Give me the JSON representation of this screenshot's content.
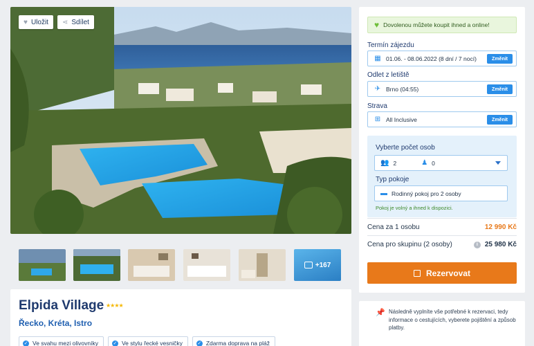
{
  "hero": {
    "save_label": "Uložit",
    "share_label": "Sdílet"
  },
  "gallery": {
    "more_label": "+167"
  },
  "hotel": {
    "name": "Elpida Village",
    "stars": "★★★★",
    "location": "Řecko, Kréta, Istro",
    "tags": [
      "Ve svahu mezi olivovníky",
      "Ve stylu řecké vesničky",
      "Zdarma doprava na pláž"
    ]
  },
  "booking": {
    "promo": "Dovolenou můžete koupit ihned a online!",
    "term_label": "Termín zájezdu",
    "term_value": "01.06. - 08.06.2022 (8 dní / 7 nocí)",
    "departure_label": "Odlet z letiště",
    "departure_value": "Brno (04:55)",
    "board_label": "Strava",
    "board_value": "All Inclusive",
    "change_label": "Změnit",
    "persons_label": "Vyberte počet osob",
    "adults": "2",
    "children": "0",
    "room_label": "Typ pokoje",
    "room_value": "Rodinný pokoj pro 2 osoby",
    "availability": "Pokoj je volný a ihned k dispozici.",
    "price_per_person_label": "Cena za 1 osobu",
    "price_per_person": "12 990 Kč",
    "price_group_label": "Cena pro skupinu (2 osoby)",
    "price_group": "25 980 Kč",
    "reserve_label": "Rezervovat",
    "note": "Následně vyplníte vše potřebné k rezervaci, tedy informace o cestujících, vyberete pojištění a způsob platby."
  },
  "colors": {
    "accent": "#2a8ee8",
    "cta": "#e8791a",
    "brand_text": "#1f3a6e",
    "success": "#3e8a2b"
  }
}
